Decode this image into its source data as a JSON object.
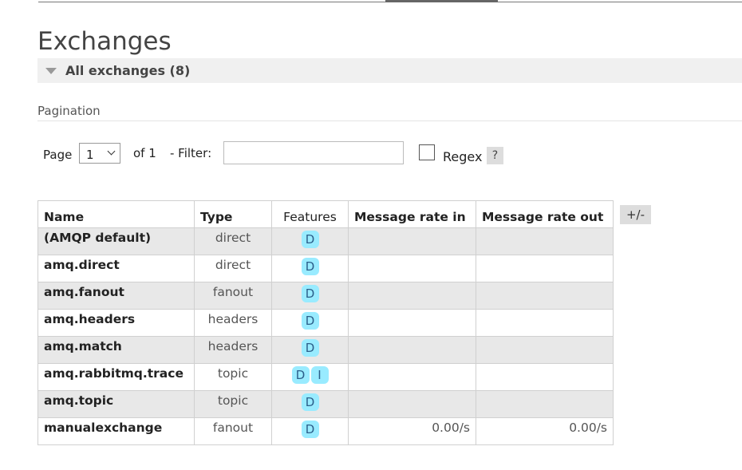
{
  "page": {
    "title": "Exchanges",
    "section_label": "All exchanges (8)"
  },
  "pagination": {
    "label": "Pagination",
    "page_word": "Page",
    "page_value": "1",
    "of_text": "of 1",
    "filter_label": "- Filter:",
    "filter_value": "",
    "regex_label": "Regex",
    "help": "?"
  },
  "table": {
    "headers": {
      "name": "Name",
      "type": "Type",
      "features": "Features",
      "rate_in": "Message rate in",
      "rate_out": "Message rate out"
    },
    "columns_toggle": "+/-",
    "rows": [
      {
        "name": "(AMQP default)",
        "type": "direct",
        "features": [
          "D"
        ],
        "rate_in": "",
        "rate_out": ""
      },
      {
        "name": "amq.direct",
        "type": "direct",
        "features": [
          "D"
        ],
        "rate_in": "",
        "rate_out": ""
      },
      {
        "name": "amq.fanout",
        "type": "fanout",
        "features": [
          "D"
        ],
        "rate_in": "",
        "rate_out": ""
      },
      {
        "name": "amq.headers",
        "type": "headers",
        "features": [
          "D"
        ],
        "rate_in": "",
        "rate_out": ""
      },
      {
        "name": "amq.match",
        "type": "headers",
        "features": [
          "D"
        ],
        "rate_in": "",
        "rate_out": ""
      },
      {
        "name": "amq.rabbitmq.trace",
        "type": "topic",
        "features": [
          "D",
          "I"
        ],
        "rate_in": "",
        "rate_out": ""
      },
      {
        "name": "amq.topic",
        "type": "topic",
        "features": [
          "D"
        ],
        "rate_in": "",
        "rate_out": ""
      },
      {
        "name": "manualexchange",
        "type": "fanout",
        "features": [
          "D"
        ],
        "rate_in": "0.00/s",
        "rate_out": "0.00/s"
      }
    ]
  },
  "colors": {
    "badge_bg": "#99ebff",
    "badge_text": "#2c5f8a",
    "row_alt": "#e8e8e8",
    "section_bg": "#f0f0f0"
  }
}
